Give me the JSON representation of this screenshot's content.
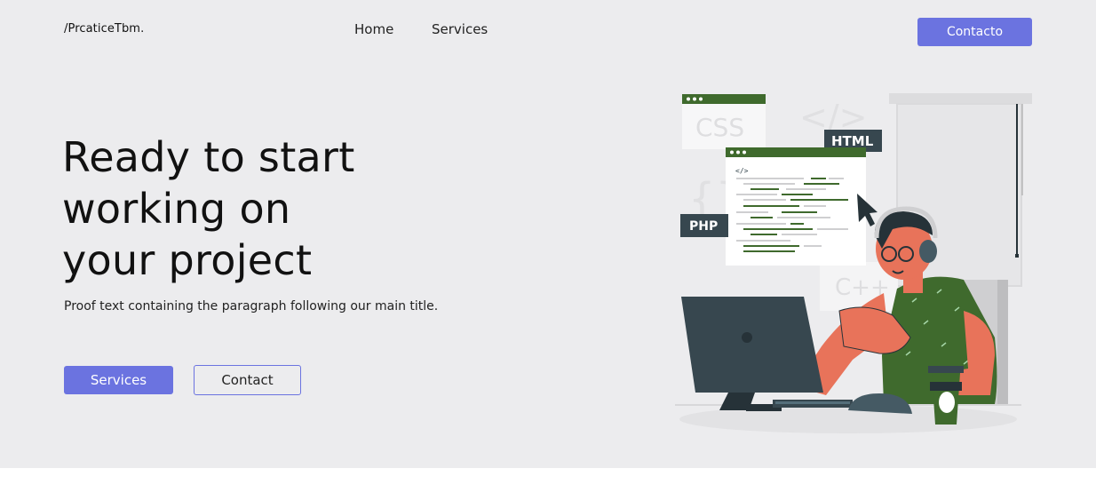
{
  "header": {
    "logo": "/PrcaticeTbm.",
    "nav": [
      "Home",
      "Services"
    ],
    "contact_button": "Contacto"
  },
  "hero": {
    "title_lines": [
      "Ready to start",
      "working on",
      "your project"
    ],
    "subtitle": "Proof text containing the paragraph following our main title.",
    "primary_button": "Services",
    "secondary_button": "Contact"
  },
  "illustration": {
    "labels": [
      "CSS",
      "HTML",
      "PHP",
      "C++"
    ],
    "code_tag": "</>"
  },
  "colors": {
    "accent": "#6b73e0",
    "background": "#ececee",
    "green": "#3f6a2d",
    "skin": "#e8735a",
    "dark": "#37474f"
  }
}
